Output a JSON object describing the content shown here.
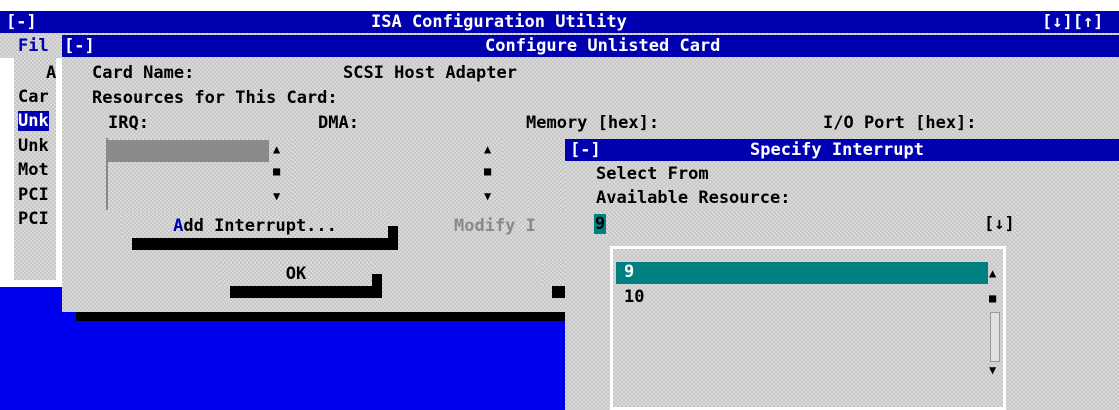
{
  "main_window": {
    "sysmenu": "[-]",
    "title": "ISA Configuration Utility",
    "controls": "[↓][↑]",
    "menu_partial": "Fil",
    "left_labels": [
      "A",
      "Car",
      "Unk",
      "Unk",
      "Mot",
      "PCI",
      "PCI"
    ]
  },
  "unlisted_dialog": {
    "sysmenu": "[-]",
    "title": "Configure Unlisted Card",
    "card_name_label": "Card Name:",
    "card_name_value": "SCSI Host Adapter",
    "resources_label": "Resources for This Card:",
    "irq_header": "IRQ:",
    "dma_header": "DMA:",
    "memory_header": "Memory [hex]:",
    "io_header": "I/O Port [hex]:",
    "add_interrupt_button": "Add Interrupt...",
    "add_interrupt_hotkey": "A",
    "add_interrupt_rest": "dd Interrupt...",
    "modify_button_partial": "Modify I",
    "ok_button": "OK"
  },
  "interrupt_dialog": {
    "sysmenu": "[-]",
    "title": "Specify Interrupt",
    "select_from": "Select From",
    "available_resource": "Available Resource:",
    "combo_value": "9",
    "combo_arrow": "[↓]",
    "options": [
      "9",
      "10"
    ],
    "selected_index": 0
  },
  "colors": {
    "title_bar": "#0000b0",
    "desktop": "#0000f0",
    "selection": "#008080",
    "dialog_gray": "#c6c6c6"
  }
}
